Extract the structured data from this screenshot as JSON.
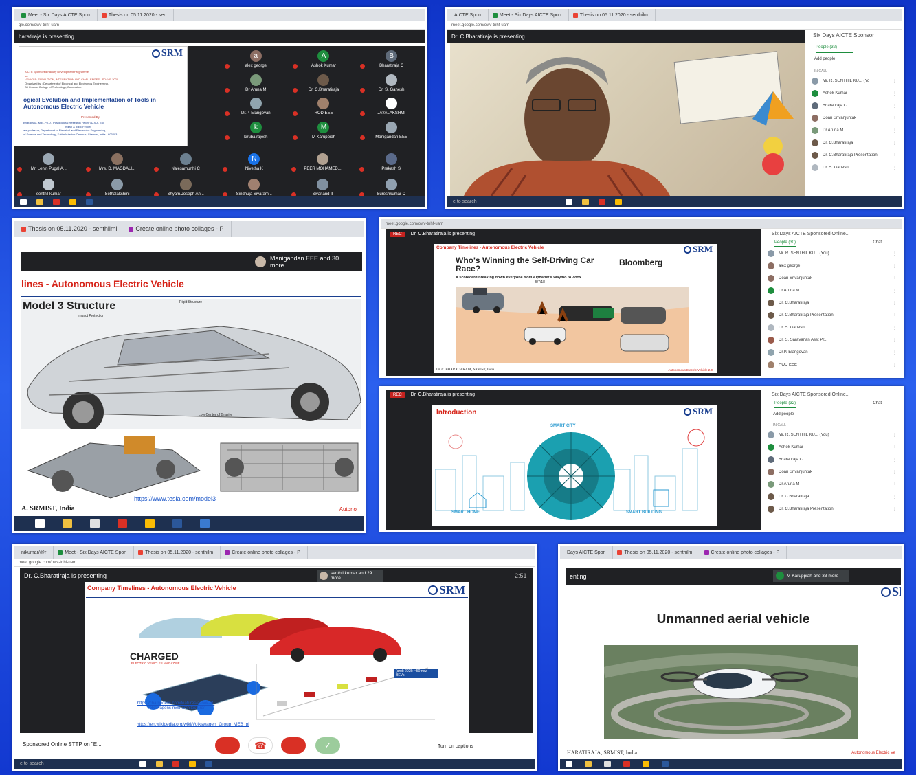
{
  "p1": {
    "tabs": [
      "Meet - Six Days AICTE Spon",
      "Thesis on 05.11.2020 - sen"
    ],
    "url": "gle.com/owv-tnhf-uam",
    "banner": "haratiraja is presenting",
    "slide": {
      "line1": "AICTE Sponsored Faculty Development Programme",
      "line2": "on",
      "line3": "VEHICLE: EVOLUTION, INTEGRATION AND CHALLENGES - SDAVE-2020",
      "line4": "Organized by : Department of Electrical and Electronics Engineering,",
      "line5": "Sri Krishna College of Technology, Coimbatore.",
      "title": "ogical Evolution and Implementation of Tools in  Autonomous Electric Vehicle",
      "presented": "Presented By",
      "name": "Bharatiraja, M.E.,Ph.D., Postdoctoral Research Fellow (U.S.A. Etc",
      "name2": "India ) & IEEE Fellow",
      "dept": "ate professor, Department of Electrical and Electronics Engineering,",
      "inst": "of Science and Technology, Kattankulathur Campus, Chennai, India - 603203."
    },
    "participants": [
      {
        "name": "alex george",
        "letter": "a",
        "color": "#8d6e63"
      },
      {
        "name": "Ashok Kumar",
        "letter": "A",
        "color": "#1e8e3e"
      },
      {
        "name": "Bharatiraja C",
        "letter": "B",
        "color": "#5f6b7a"
      },
      {
        "name": "Dr Aruna M",
        "letter": "",
        "color": "#7a9a7a"
      },
      {
        "name": "Dr. C.Bharatiraja",
        "letter": "",
        "color": "#6d5a4a"
      },
      {
        "name": "Dr. S. Ganesh",
        "letter": "",
        "color": "#b0b8c0"
      },
      {
        "name": "Dr.P. Elangovan",
        "letter": "",
        "color": "#90a4ae"
      },
      {
        "name": "HOD EEE",
        "letter": "",
        "color": "#a0816c"
      },
      {
        "name": "JAYALAKSHMI",
        "letter": "",
        "color": "#ffffff"
      },
      {
        "name": "kiruba rajesh",
        "letter": "k",
        "color": "#1e8e3e"
      },
      {
        "name": "M Karuppiah",
        "letter": "M",
        "color": "#1e8e3e"
      },
      {
        "name": "Manigandan EEE",
        "letter": "",
        "color": "#9aa7b3"
      },
      {
        "name": "Mr. Lenin Pugal A...",
        "letter": "",
        "color": "#9aa7b3"
      },
      {
        "name": "Mrs. D. MAGDALI...",
        "letter": "",
        "color": "#8a7060"
      },
      {
        "name": "Nalesamurthi C",
        "letter": "",
        "color": "#6c8090"
      },
      {
        "name": "Nivetha K",
        "letter": "N",
        "color": "#1a73e8"
      },
      {
        "name": "PEER MOHAMED...",
        "letter": "",
        "color": "#b0a090"
      },
      {
        "name": "Prakash S",
        "letter": "",
        "color": "#5a6a8a"
      },
      {
        "name": "senthil kumar",
        "letter": "",
        "color": "#c0c8d0"
      },
      {
        "name": "Sethalakshmi",
        "letter": "",
        "color": "#8a9aa8"
      },
      {
        "name": "Shyam.Joseph An...",
        "letter": "",
        "color": "#7a6a5a"
      },
      {
        "name": "Sindhuja Sivaram...",
        "letter": "",
        "color": "#a08070"
      },
      {
        "name": "Sivanand II",
        "letter": "",
        "color": "#8090a0"
      },
      {
        "name": "Sureshkumar C",
        "letter": "",
        "color": "#90a0b0"
      }
    ]
  },
  "p2": {
    "tabs": [
      "AICTE Spon",
      "Meet - Six Days AICTE Spon",
      "Thesis on 05.11.2020 - senthilm"
    ],
    "url": "meet.google.com/owv-tnhf-uam",
    "banner": "Dr. C.Bharatiraja is presenting",
    "panel_title": "Six Days AICTE Sponsor",
    "people_tab": "People (32)",
    "add_people": "Add people",
    "in_call": "IN CALL",
    "people": [
      {
        "name": "Mr. R. SENTHIL KU... (Yo",
        "color": "#8a9aa8"
      },
      {
        "name": "Ashok Kumar",
        "color": "#1e8e3e"
      },
      {
        "name": "Bharatiraja C",
        "color": "#5f6b7a"
      },
      {
        "name": "Doan Srivanjuntak",
        "color": "#8d6e63"
      },
      {
        "name": "Dr Aruna M",
        "color": "#7a9a7a"
      },
      {
        "name": "Dr. C.Bharatiraja",
        "color": "#6d5a4a"
      },
      {
        "name": "Dr. C.Bharatiraja Presentation",
        "color": "#6d5a4a"
      },
      {
        "name": "Dr. S. Ganesh",
        "color": "#b0b8c0"
      }
    ],
    "taskbar": "e to search"
  },
  "p3": {
    "tabs": [
      "Thesis on 05.11.2020 - senthilmi",
      "Create online photo collages - P"
    ],
    "overlay": "Manigandan EEE and 30 more",
    "slide_title": "lines - Autonomous Electric Vehicle",
    "model": "Model 3 Structure",
    "label_rigid": "Rigid Structure",
    "label_impact": "Impact Protection",
    "label_cog": "Low Center of Gravity",
    "link": "https://www.tesla.com/model3",
    "footer": "A. SRMIST, India",
    "footer_r": "Autono"
  },
  "p4": {
    "url": "meet.google.com/owv-tnhf-uam",
    "rec": "REC",
    "banner": "Dr. C.Bharatiraja is presenting",
    "slide_title": "Company Timelines - Autonomous Electric Vehicle",
    "headline": "Who's Winning the Self-Driving Car Race?",
    "sub": "A scorecard breaking down everyone from Alphabet's Waymo to Zoox.",
    "date": "5/7/18",
    "bloomberg": "Bloomberg",
    "footer": "Dr. C. BHARATHIRAJA, SRMIST, India",
    "footer_r": "Autonomous Electric Vehicle 2.0",
    "panel_title": "Six Days AICTE Sponsored Online...",
    "people_tab": "People (30)",
    "chat": "Chat",
    "people": [
      {
        "name": "Mr. R. SENTHIL KU... (You)",
        "color": "#8a9aa8"
      },
      {
        "name": "alex george",
        "color": "#8d6e63"
      },
      {
        "name": "Doan Srivanjuntak",
        "color": "#8d6e63"
      },
      {
        "name": "Dr Aruna M",
        "color": "#1e8e3e"
      },
      {
        "name": "Dr. C.Bharatiraja",
        "color": "#6d5a4a"
      },
      {
        "name": "Dr. C.Bharatiraja Presentation",
        "color": "#6d5a4a"
      },
      {
        "name": "Dr. S. Ganesh",
        "color": "#b0b8c0"
      },
      {
        "name": "Dr. S. Saravanan Asst Pr...",
        "color": "#9a5a4a"
      },
      {
        "name": "Dr.P. Elangovan",
        "color": "#90a4ae"
      },
      {
        "name": "HOD EEE",
        "color": "#a0816c"
      }
    ]
  },
  "p5": {
    "rec": "REC",
    "banner": "Dr. C.Bharatiraja is presenting",
    "slide_title": "Introduction",
    "city": "SMART CITY",
    "home": "SMART HOME",
    "building": "SMART BUILDING",
    "panel_title": "Six Days AICTE Sponsored Online...",
    "people_tab": "People (32)",
    "chat": "Chat",
    "add_people": "Add people",
    "in_call": "IN CALL",
    "people": [
      {
        "name": "Mr. R. SENTHIL KU... (You)",
        "color": "#8a9aa8"
      },
      {
        "name": "Ashok Kumar",
        "color": "#1e8e3e"
      },
      {
        "name": "Bharatiraja C",
        "color": "#5f6b7a"
      },
      {
        "name": "Doan Srivanjuntak",
        "color": "#8d6e63"
      },
      {
        "name": "Dr Aruna M",
        "color": "#7a9a7a"
      },
      {
        "name": "Dr. C.Bharatiraja",
        "color": "#6d5a4a"
      },
      {
        "name": "Dr. C.Bharatiraja Presentation",
        "color": "#6d5a4a"
      }
    ]
  },
  "p6": {
    "tabs": [
      "nikumar/@r",
      "Meet - Six Days AICTE Spon",
      "Thesis on 05.11.2020 - senthilm",
      "Create online photo collages - P"
    ],
    "url": "meet.google.com/owv-tnhf-uam",
    "banner": "Dr. C.Bharatiraja is presenting",
    "overlay": "senthil kumar and 29 more",
    "time": "2:51",
    "slide_title": "Company Timelines - Autonomous Electric Vehicle",
    "charged": "CHARGED",
    "charged_sub": "ELECTRIC VEHICLES MAGAZINE",
    "link1": "https://chargedevs.com/features/a-look-at-volkswagens-meb-architecture/",
    "link2": "https://en.wikipedia.org/wiki/Volkswagen_Group_MEB_pl",
    "chart_note": "(and) 2025: ~50 new BEVs",
    "bottom_left": "Sponsored Online STTP on \"E...",
    "captions": "Turn on captions",
    "taskbar": "e to search"
  },
  "p7": {
    "tabs": [
      "Days AICTE Spon",
      "Thesis on 05.11.2020 - senthilm",
      "Create online photo collages - P"
    ],
    "banner": "enting",
    "overlay": "M Karuppiah and 33 more",
    "title": "Unmanned aerial vehicle",
    "footer": "HARATIRAJA, SRMIST, India",
    "footer_r": "Autonomous Electric Ve"
  }
}
